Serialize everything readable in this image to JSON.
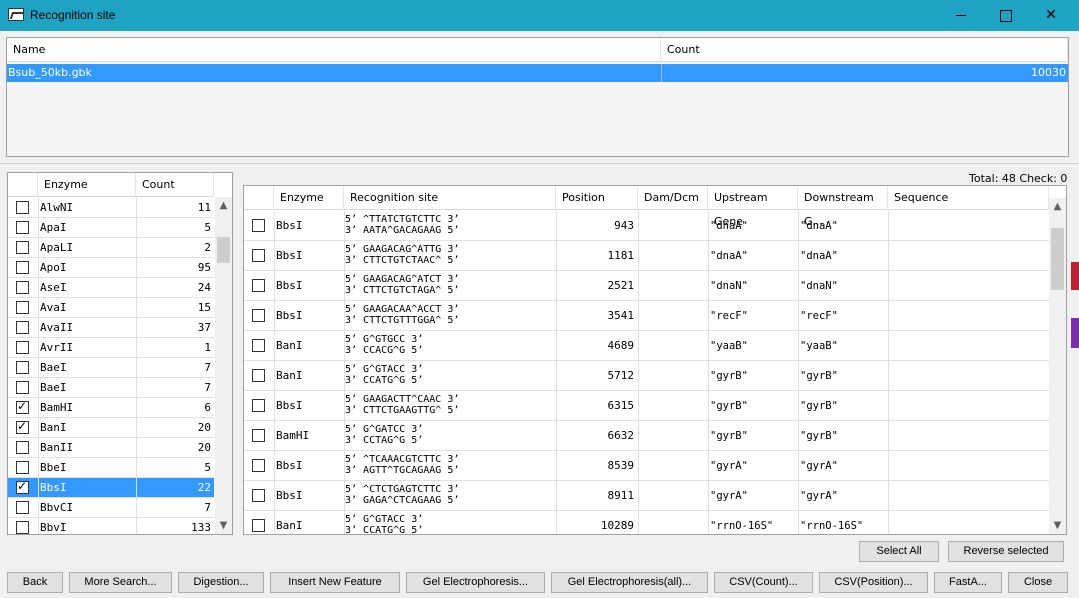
{
  "window": {
    "title": "Recognition site"
  },
  "file_list": {
    "headers": [
      "Name",
      "Count"
    ],
    "rows": [
      {
        "name": "Bsub_50kb.gbk",
        "count": "10030"
      }
    ]
  },
  "enzyme_list": {
    "headers": [
      "Enzyme",
      "Count"
    ],
    "rows": [
      {
        "name": "AlwNI",
        "count": "11",
        "checked": false,
        "selected": false
      },
      {
        "name": "ApaI",
        "count": "5",
        "checked": false,
        "selected": false
      },
      {
        "name": "ApaLI",
        "count": "2",
        "checked": false,
        "selected": false
      },
      {
        "name": "ApoI",
        "count": "95",
        "checked": false,
        "selected": false
      },
      {
        "name": "AseI",
        "count": "24",
        "checked": false,
        "selected": false
      },
      {
        "name": "AvaI",
        "count": "15",
        "checked": false,
        "selected": false
      },
      {
        "name": "AvaII",
        "count": "37",
        "checked": false,
        "selected": false
      },
      {
        "name": "AvrII",
        "count": "1",
        "checked": false,
        "selected": false
      },
      {
        "name": "BaeI",
        "count": "7",
        "checked": false,
        "selected": false
      },
      {
        "name": "BaeI",
        "count": "7",
        "checked": false,
        "selected": false
      },
      {
        "name": "BamHI",
        "count": "6",
        "checked": true,
        "selected": false
      },
      {
        "name": "BanI",
        "count": "20",
        "checked": true,
        "selected": false
      },
      {
        "name": "BanII",
        "count": "20",
        "checked": false,
        "selected": false
      },
      {
        "name": "BbeI",
        "count": "5",
        "checked": false,
        "selected": false
      },
      {
        "name": "BbsI",
        "count": "22",
        "checked": true,
        "selected": true
      },
      {
        "name": "BbvCI",
        "count": "7",
        "checked": false,
        "selected": false
      },
      {
        "name": "BbvI",
        "count": "133",
        "checked": false,
        "selected": false
      }
    ]
  },
  "summary": {
    "text": "Total: 48  Check: 0"
  },
  "results": {
    "headers": [
      "Enzyme",
      "Recognition site",
      "Position",
      "Dam/Dcm",
      "Upstream Gene",
      "Downstream G...",
      "Sequence"
    ],
    "rows": [
      {
        "enzyme": "BbsI",
        "site1": "5’  ^TTATCTGTCTTC 3’",
        "site2": "3’  AATA^GACAGAAG 5’",
        "position": "943",
        "damdcm": "",
        "up": "\"dnaA\"",
        "down": "\"dnaA\"",
        "seq": ""
      },
      {
        "enzyme": "BbsI",
        "site1": "5’  GAAGACAG^ATTG 3’",
        "site2": "3’  CTTCTGTCTAAC^ 5’",
        "position": "1181",
        "damdcm": "",
        "up": "\"dnaA\"",
        "down": "\"dnaA\"",
        "seq": ""
      },
      {
        "enzyme": "BbsI",
        "site1": "5’  GAAGACAG^ATCT 3’",
        "site2": "3’  CTTCTGTCTAGA^ 5’",
        "position": "2521",
        "damdcm": "",
        "up": "\"dnaN\"",
        "down": "\"dnaN\"",
        "seq": ""
      },
      {
        "enzyme": "BbsI",
        "site1": "5’  GAAGACAA^ACCT 3’",
        "site2": "3’  CTTCTGTTTGGA^ 5’",
        "position": "3541",
        "damdcm": "",
        "up": "\"recF\"",
        "down": "\"recF\"",
        "seq": ""
      },
      {
        "enzyme": "BanI",
        "site1": "5’  G^GTGCC 3’",
        "site2": "3’  CCACG^G 5’",
        "position": "4689",
        "damdcm": "",
        "up": "\"yaaB\"",
        "down": "\"yaaB\"",
        "seq": ""
      },
      {
        "enzyme": "BanI",
        "site1": "5’  G^GTACC 3’",
        "site2": "3’  CCATG^G 5’",
        "position": "5712",
        "damdcm": "",
        "up": "\"gyrB\"",
        "down": "\"gyrB\"",
        "seq": ""
      },
      {
        "enzyme": "BbsI",
        "site1": "5’  GAAGACTT^CAAC 3’",
        "site2": "3’  CTTCTGAAGTTG^ 5’",
        "position": "6315",
        "damdcm": "",
        "up": "\"gyrB\"",
        "down": "\"gyrB\"",
        "seq": ""
      },
      {
        "enzyme": "BamHI",
        "site1": "5’  G^GATCC 3’",
        "site2": "3’  CCTAG^G 5’",
        "position": "6632",
        "damdcm": "",
        "up": "\"gyrB\"",
        "down": "\"gyrB\"",
        "seq": ""
      },
      {
        "enzyme": "BbsI",
        "site1": "5’  ^TCAAACGTCTTC 3’",
        "site2": "3’  AGTT^TGCAGAAG 5’",
        "position": "8539",
        "damdcm": "",
        "up": "\"gyrA\"",
        "down": "\"gyrA\"",
        "seq": ""
      },
      {
        "enzyme": "BbsI",
        "site1": "5’  ^CTCTGAGTCTTC 3’",
        "site2": "3’  GAGA^CTCAGAAG 5’",
        "position": "8911",
        "damdcm": "",
        "up": "\"gyrA\"",
        "down": "\"gyrA\"",
        "seq": ""
      },
      {
        "enzyme": "BanI",
        "site1": "5’  G^GTACC 3’",
        "site2": "3’  CCATG^G 5’",
        "position": "10289",
        "damdcm": "",
        "up": "\"rrnO-16S\"",
        "down": "\"rrnO-16S\"",
        "seq": ""
      }
    ]
  },
  "actions": {
    "select_all": "Select All",
    "reverse_selected": "Reverse selected"
  },
  "bottom_buttons": {
    "back": "Back",
    "more_search": "More Search...",
    "digestion": "Digestion...",
    "insert_feature": "Insert New Feature",
    "gel": "Gel Electrophoresis...",
    "gel_all": "Gel Electrophoresis(all)...",
    "csv_count": "CSV(Count)...",
    "csv_position": "CSV(Position)...",
    "fasta": "FastA...",
    "close": "Close"
  }
}
